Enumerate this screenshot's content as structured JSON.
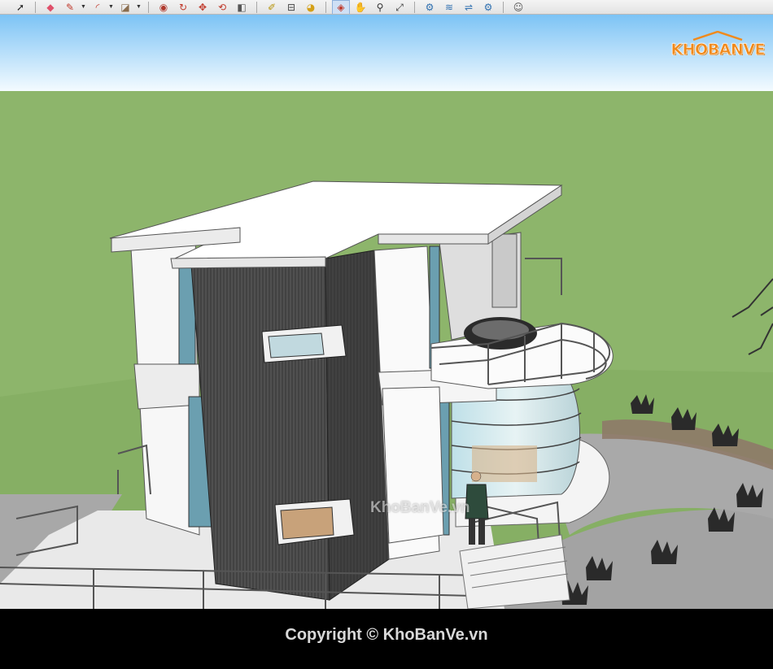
{
  "toolbar": {
    "tools": [
      {
        "name": "select-tool",
        "glyph": "➚",
        "color": "#222222"
      },
      {
        "name": "eraser-tool",
        "glyph": "◆",
        "color": "#e0506a"
      },
      {
        "name": "pencil-tool",
        "glyph": "✎",
        "color": "#c0392b"
      },
      {
        "name": "arc-tool",
        "glyph": "◜",
        "color": "#c0392b"
      },
      {
        "name": "rectangle-tool",
        "glyph": "◪",
        "color": "#8a6d4e"
      },
      {
        "name": "push-pull-tool",
        "glyph": "◉",
        "color": "#b03a2e"
      },
      {
        "name": "follow-me-tool",
        "glyph": "↻",
        "color": "#c0392b"
      },
      {
        "name": "move-tool",
        "glyph": "✥",
        "color": "#c0392b"
      },
      {
        "name": "rotate-tool",
        "glyph": "⟲",
        "color": "#c0392b"
      },
      {
        "name": "offset-tool",
        "glyph": "◧",
        "color": "#555555"
      },
      {
        "name": "tape-measure-tool",
        "glyph": "✐",
        "color": "#b7950b"
      },
      {
        "name": "text-tool",
        "glyph": "⊟",
        "color": "#444444"
      },
      {
        "name": "paint-bucket-tool",
        "glyph": "◕",
        "color": "#d4a017"
      },
      {
        "name": "orbit-tool",
        "glyph": "◈",
        "color": "#c0392b"
      },
      {
        "name": "pan-tool",
        "glyph": "✋",
        "color": "#d9a66a"
      },
      {
        "name": "zoom-tool",
        "glyph": "⚲",
        "color": "#333333"
      },
      {
        "name": "zoom-extents-tool",
        "glyph": "⤢",
        "color": "#333333"
      },
      {
        "name": "walk-tool",
        "glyph": "⚙",
        "color": "#2e6fb0"
      },
      {
        "name": "position-camera-tool",
        "glyph": "≋",
        "color": "#2e6fb0"
      },
      {
        "name": "look-around-tool",
        "glyph": "⇌",
        "color": "#2e6fb0"
      },
      {
        "name": "settings-tool",
        "glyph": "⚙",
        "color": "#2e6fb0"
      },
      {
        "name": "account-tool",
        "glyph": "☺",
        "color": "#555555"
      }
    ],
    "active_tool": "orbit-tool"
  },
  "logo": {
    "text": "KHOBANVE",
    "color": "#f08a1c"
  },
  "watermark": {
    "text": "KhoBanVe.vn"
  },
  "footer": {
    "copyright": "Copyright © KhoBanVe.vn"
  },
  "scene": {
    "sky_color": "#cfe9ff",
    "ground_color": "#8db56b",
    "paving_color": "#a7a7a7",
    "wall_color": "#ffffff",
    "cladding_color": "#4a4a4a"
  }
}
